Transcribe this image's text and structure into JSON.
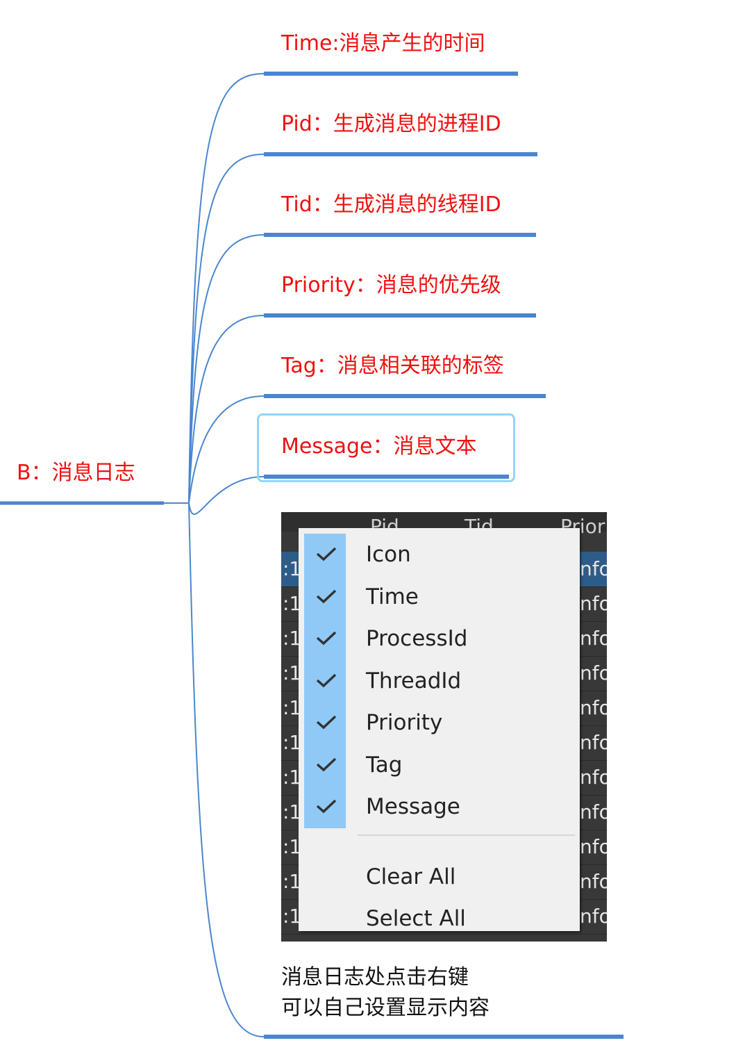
{
  "colors": {
    "branch": "#4a86d0",
    "node_text": "#f01010",
    "highlight": "#8fd6f7",
    "check_column": "#91c9f6"
  },
  "root": {
    "label": "B：消息日志"
  },
  "branches": [
    {
      "label": "Time:消息产生的时间"
    },
    {
      "label": "Pid：生成消息的进程ID"
    },
    {
      "label": "Tid：生成消息的线程ID"
    },
    {
      "label": "Priority：消息的优先级"
    },
    {
      "label": "Tag：消息相关联的标签"
    },
    {
      "label": "Message：消息文本",
      "highlighted": true
    }
  ],
  "screenshot": {
    "headers": [
      "Pid",
      "Tid",
      "Prior"
    ],
    "row_left_fragment": ":1",
    "row_right_fragment": "nfo",
    "menu": {
      "checked_items": [
        {
          "label": "Icon",
          "checked": true,
          "icon": "check-icon"
        },
        {
          "label": "Time",
          "checked": true,
          "icon": "check-icon"
        },
        {
          "label": "ProcessId",
          "checked": true,
          "icon": "check-icon"
        },
        {
          "label": "ThreadId",
          "checked": true,
          "icon": "check-icon"
        },
        {
          "label": "Priority",
          "checked": true,
          "icon": "check-icon"
        },
        {
          "label": "Tag",
          "checked": true,
          "icon": "check-icon"
        },
        {
          "label": "Message",
          "checked": true,
          "icon": "check-icon"
        }
      ],
      "actions": [
        {
          "label": "Clear All"
        },
        {
          "label": "Select All"
        }
      ]
    }
  },
  "caption": {
    "line1": "消息日志处点击右键",
    "line2": "可以自己设置显示内容"
  }
}
